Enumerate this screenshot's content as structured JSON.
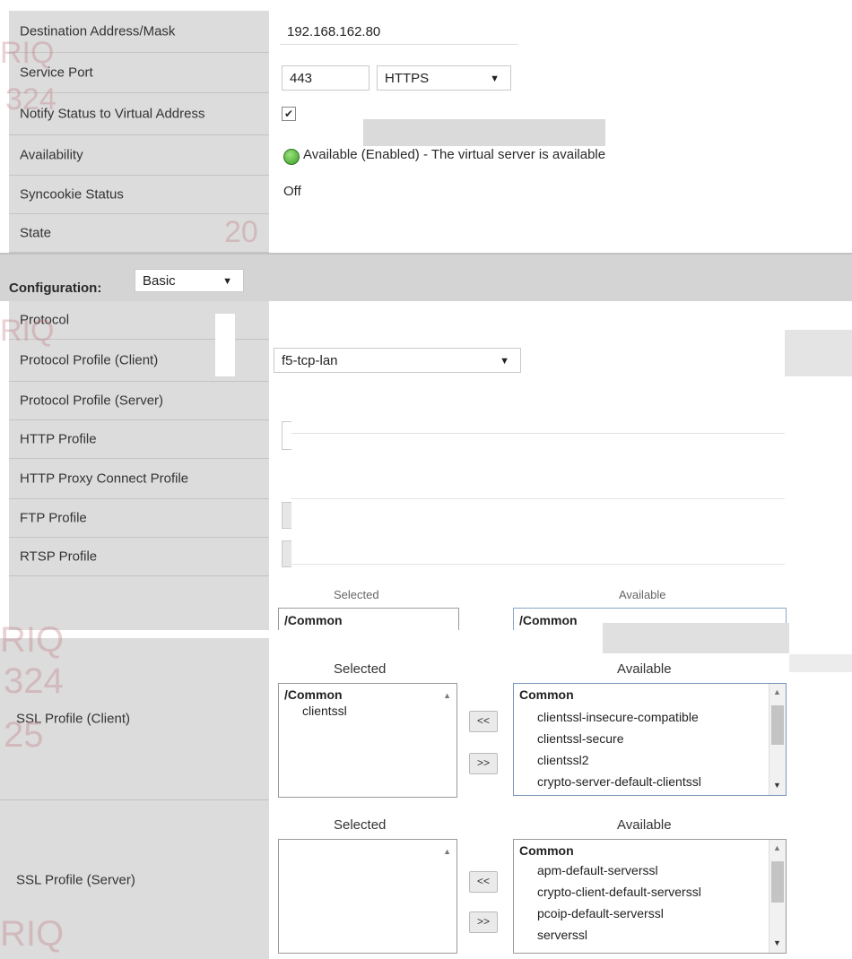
{
  "general": {
    "destination_label": "Destination Address/Mask",
    "destination_value": "192.168.162.80",
    "service_port_label": "Service Port",
    "service_port_value": "443",
    "service_port_protocol": "HTTPS",
    "notify_label": "Notify Status to Virtual Address",
    "notify_checked": "✔",
    "availability_label": "Availability",
    "availability_value": "Available (Enabled) - The virtual server is available",
    "syncookie_label": "Syncookie Status",
    "syncookie_value": "Off",
    "state_label": "State"
  },
  "configuration": {
    "label": "Configuration:",
    "mode": "Basic"
  },
  "protocol": {
    "protocol_label": "Protocol",
    "client_profile_label": "Protocol Profile (Client)",
    "client_profile_value": "f5-tcp-lan",
    "server_profile_label": "Protocol Profile (Server)",
    "http_profile_label": "HTTP Profile",
    "http_proxy_label": "HTTP Proxy Connect Profile",
    "ftp_label": "FTP Profile",
    "rtsp_label": "RTSP Profile"
  },
  "partial_lists": {
    "selected_header": "Selected",
    "available_header": "Available",
    "selected_group": "/Common",
    "available_group": "/Common"
  },
  "ssl_client": {
    "label": "SSL Profile (Client)",
    "selected_header": "Selected",
    "available_header": "Available",
    "selected_group": "/Common",
    "selected_items": [
      "clientssl"
    ],
    "available_group": "Common",
    "available_items": [
      "clientssl-insecure-compatible",
      "clientssl-secure",
      "clientssl2",
      "crypto-server-default-clientssl"
    ],
    "move_left": "<<",
    "move_right": ">>"
  },
  "ssl_server": {
    "label": "SSL Profile (Server)",
    "selected_header": "Selected",
    "available_header": "Available",
    "available_group": "Common",
    "available_items": [
      "apm-default-serverssl",
      "crypto-client-default-serverssl",
      "pcoip-default-serverssl",
      "serverssl"
    ],
    "move_left": "<<",
    "move_right": ">>"
  },
  "watermarks": [
    "RIQ",
    "324",
    "25",
    "20"
  ],
  "colors": {
    "label_bg": "#dcdcdc",
    "status_green": "#3b9a2a"
  }
}
